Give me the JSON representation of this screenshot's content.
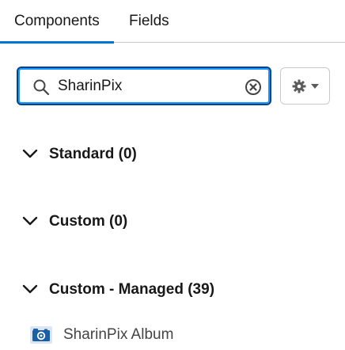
{
  "tabs": {
    "components": "Components",
    "fields": "Fields",
    "active": "Components"
  },
  "search": {
    "value": "SharinPix"
  },
  "sections": {
    "standard": "Standard (0)",
    "custom": "Custom (0)",
    "managed": "Custom - Managed (39)"
  },
  "components": {
    "items": [
      {
        "label": "SharinPix Album",
        "icon": "camera-icon"
      }
    ]
  },
  "colors": {
    "accent": "#0176d3",
    "focus_border": "#014486",
    "icon_blue": "#1b5fa6",
    "border_gray": "#c9c9c9"
  }
}
